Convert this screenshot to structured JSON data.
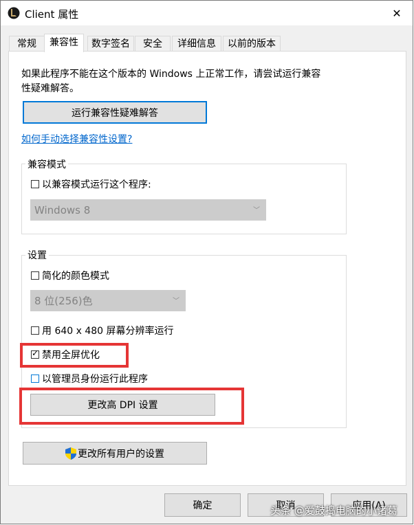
{
  "window": {
    "title": "Client 属性",
    "close_glyph": "✕"
  },
  "tabs": [
    {
      "label": "常规"
    },
    {
      "label": "兼容性"
    },
    {
      "label": "数字签名"
    },
    {
      "label": "安全"
    },
    {
      "label": "详细信息"
    },
    {
      "label": "以前的版本"
    }
  ],
  "intro": {
    "line1": "如果此程序不能在这个版本的 Windows 上正常工作，请尝试运行兼容",
    "line2": "性疑难解答。"
  },
  "troubleshoot_button": "运行兼容性疑难解答",
  "manual_link": "如何手动选择兼容性设置?",
  "compat_mode": {
    "group_label": "兼容模式",
    "checkbox_label": "以兼容模式运行这个程序:",
    "checked": false,
    "select_value": "Windows 8"
  },
  "settings": {
    "group_label": "设置",
    "reduced_color": {
      "label": "简化的颜色模式",
      "checked": false
    },
    "color_select": "8 位(256)色",
    "res_640": {
      "label": "用 640 x 480 屏幕分辨率运行",
      "checked": false
    },
    "fullscreen_opt": {
      "label": "禁用全屏优化",
      "checked": true
    },
    "run_admin": {
      "label": "以管理员身份运行此程序",
      "checked": false
    },
    "dpi_button": "更改高 DPI 设置"
  },
  "all_users_button": "更改所有用户的设置",
  "footer": {
    "ok": "确定",
    "cancel": "取消",
    "apply": "应用(A)"
  },
  "watermark": "头条 @爱鼓捣电脑的小诸葛",
  "colors": {
    "highlight_red": "#e53535",
    "link_blue": "#0066cc",
    "focus_blue": "#0078d7"
  }
}
